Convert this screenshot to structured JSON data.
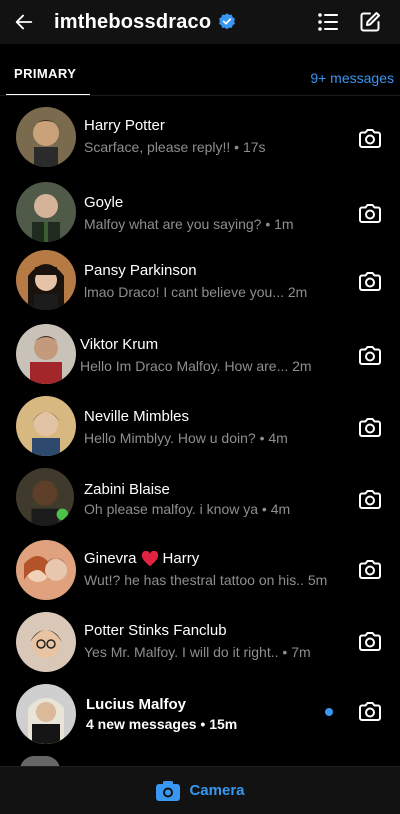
{
  "header": {
    "username": "imthebossdraco",
    "back_icon": "arrow-left-icon",
    "verified_icon": "verified-badge-icon",
    "list_icon": "list-icon",
    "compose_icon": "edit-icon"
  },
  "tabs": {
    "primary_label": "PRIMARY",
    "requests_label": "9+ messages"
  },
  "conversations": [
    {
      "name": "Harry Potter",
      "snippet": "Scarface, please reply!! • 17s",
      "unread": false
    },
    {
      "name": "Goyle",
      "snippet": "Malfoy what are you saying? • 1m",
      "unread": false
    },
    {
      "name": "Pansy Parkinson",
      "snippet": "lmao Draco! I cant believe you... 2m",
      "unread": false
    },
    {
      "name": "Viktor Krum",
      "snippet": "Hello Im Draco Malfoy. How are... 2m",
      "unread": false
    },
    {
      "name": "Neville Mimbles",
      "snippet": "Hello Mimblyy. How u doin? • 4m",
      "unread": false
    },
    {
      "name": "Zabini Blaise",
      "snippet": "Oh please malfoy. i know ya • 4m",
      "unread": false
    },
    {
      "name_a": "Ginevra",
      "name_b": "Harry",
      "snippet": "Wut!? he has thestral tattoo on his.. 5m",
      "unread": false
    },
    {
      "name": "Potter Stinks Fanclub",
      "snippet": "Yes Mr. Malfoy. I will do it right.. • 7m",
      "unread": false
    },
    {
      "name": "Lucius Malfoy",
      "snippet": "4 new messages • 15m",
      "unread": true
    }
  ],
  "bottom_bar": {
    "camera_label": "Camera",
    "camera_icon": "camera-icon"
  },
  "colors": {
    "accent": "#3897f0",
    "background": "#000000",
    "header_bg": "#121212",
    "muted_text": "#8e8e8e",
    "heart": "#e0243f"
  }
}
